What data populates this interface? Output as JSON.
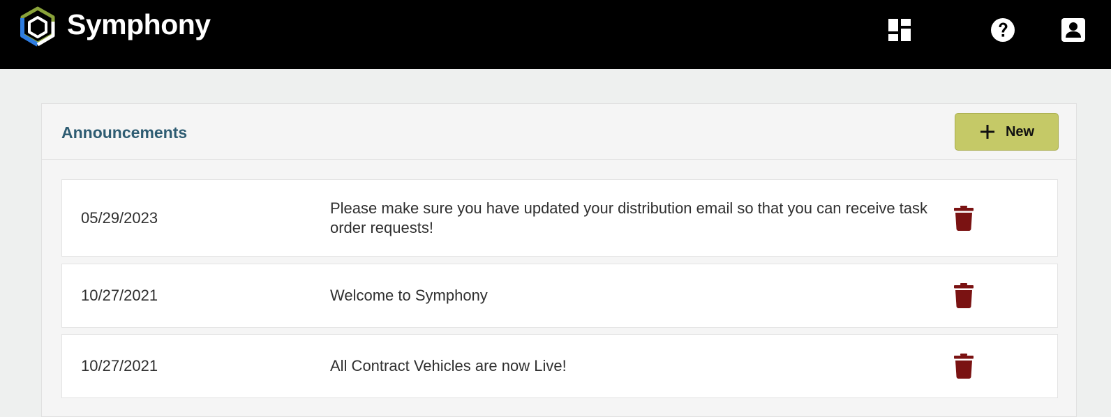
{
  "header": {
    "brand_name": "Symphony",
    "icons": {
      "logo": "symphony-hexagon-logo",
      "dashboard": "dashboard-icon",
      "help": "help-circle-icon",
      "account": "account-box-icon"
    }
  },
  "panel": {
    "title": "Announcements",
    "new_button_label": "New",
    "announcements": [
      {
        "date": "05/29/2023",
        "message": "Please make sure you have updated your distribution email so that you can receive task order requests!"
      },
      {
        "date": "10/27/2021",
        "message": "Welcome to Symphony"
      },
      {
        "date": "10/27/2021",
        "message": "All Contract Vehicles are now Live!"
      }
    ]
  },
  "colors": {
    "topbar": "#000000",
    "title": "#2e5c72",
    "new_button": "#c5c967",
    "trash": "#7a1212",
    "logo_green": "#8aa33a",
    "logo_blue": "#2f7de0"
  }
}
